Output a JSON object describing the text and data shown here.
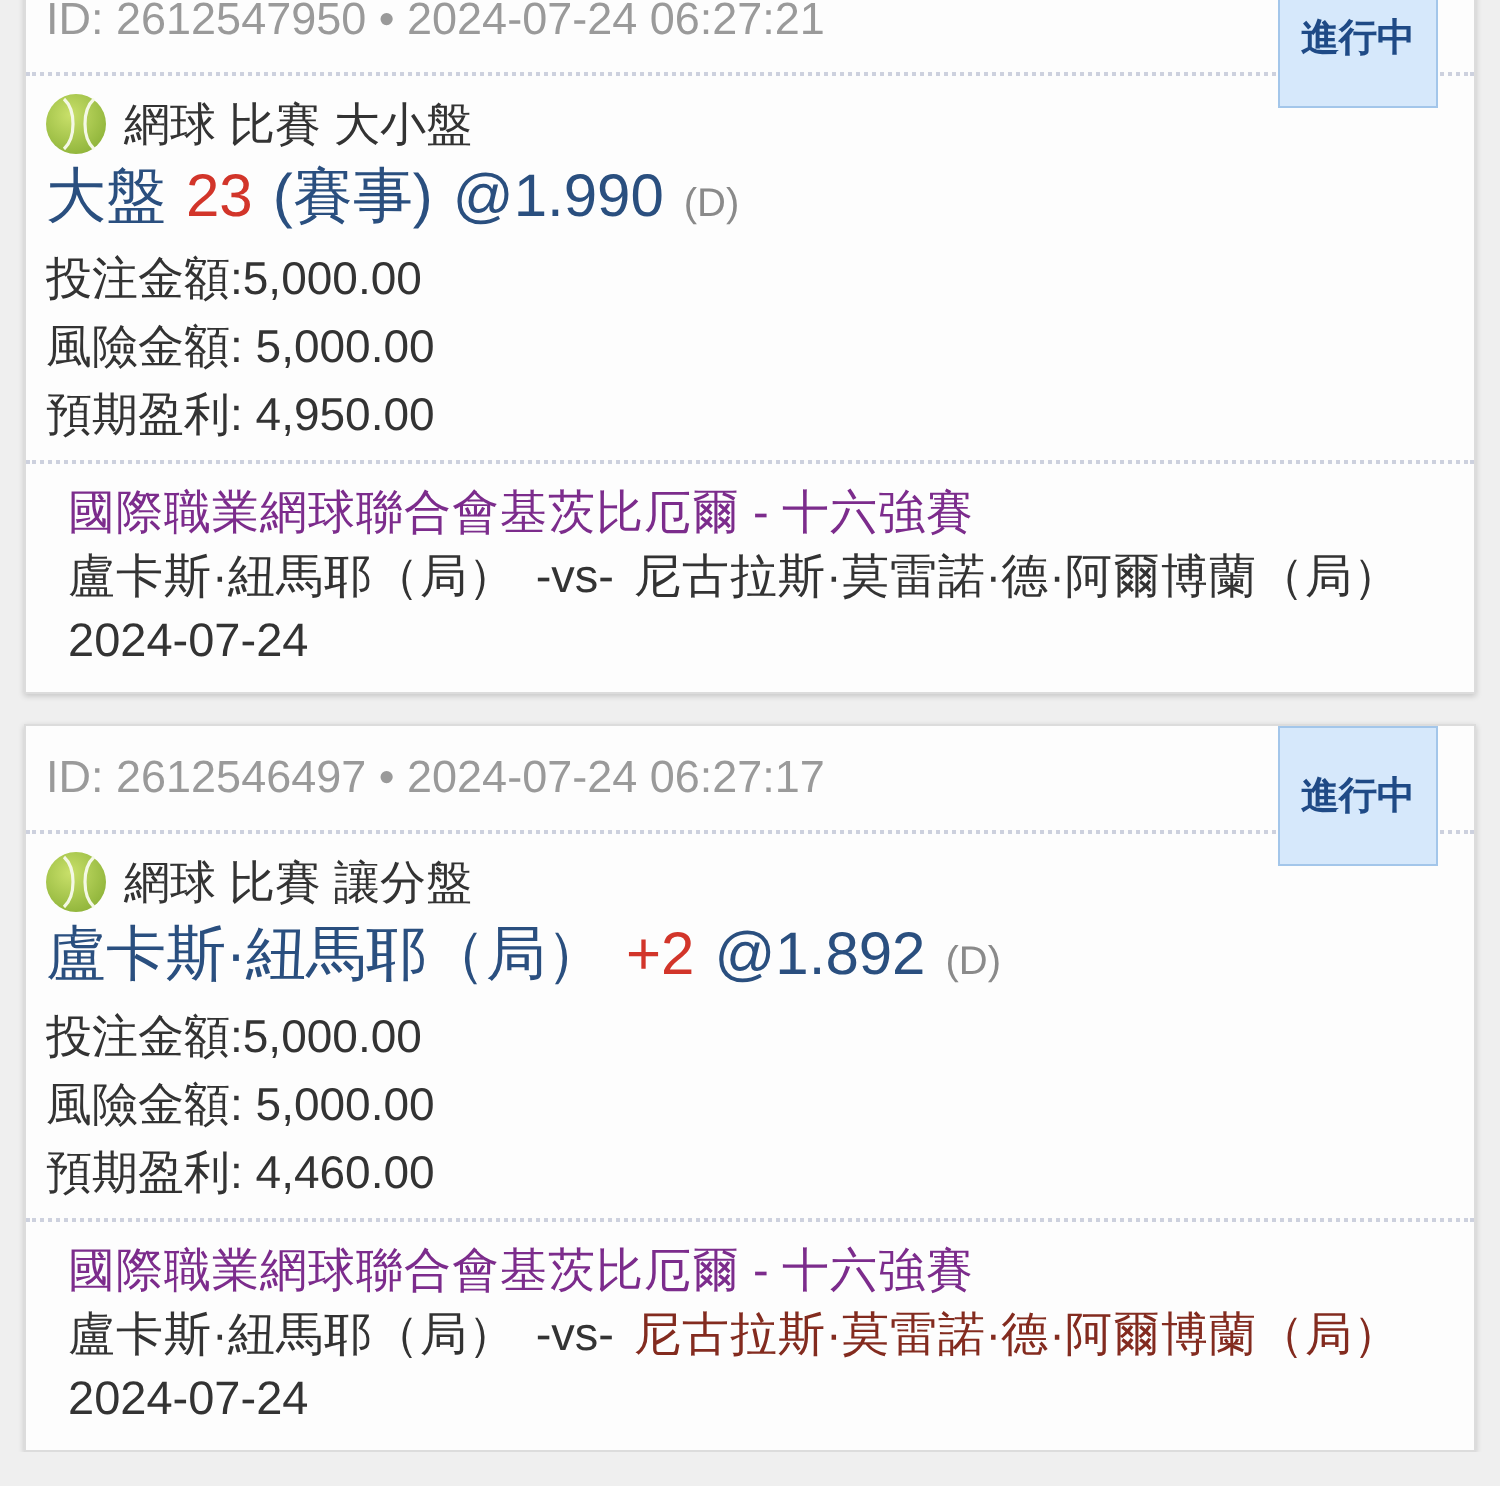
{
  "bets": [
    {
      "header": "ID: 2612547950 • 2024-07-24 06:27:21",
      "status": "進行中",
      "market": "網球 比賽 大小盤",
      "selection": [
        {
          "kind": "pick",
          "text": "大盤"
        },
        {
          "kind": "line",
          "text": "23"
        },
        {
          "kind": "pick",
          "text": "(賽事)"
        },
        {
          "kind": "odds",
          "text": "@1.990"
        },
        {
          "kind": "odds_format",
          "text": "(D)"
        }
      ],
      "details": [
        "投注金額:5,000.00",
        "風險金額: 5,000.00",
        "預期盈利: 4,950.00"
      ],
      "league": "國際職業網球聯合會基茨比厄爾 - 十六強賽",
      "home": {
        "name": "盧卡斯·紐馬耶（局）",
        "highlighted": false
      },
      "versus": "-vs-",
      "away": {
        "name": "尼古拉斯·莫雷諾·德·阿爾博蘭（局）",
        "highlighted": false
      },
      "date": "2024-07-24"
    },
    {
      "header": "ID: 2612546497 • 2024-07-24 06:27:17",
      "status": "進行中",
      "market": "網球 比賽 讓分盤",
      "selection": [
        {
          "kind": "pick",
          "text": "盧卡斯·紐馬耶（局）"
        },
        {
          "kind": "line",
          "text": "+2"
        },
        {
          "kind": "odds",
          "text": "@1.892"
        },
        {
          "kind": "odds_format",
          "text": "(D)"
        }
      ],
      "details": [
        "投注金額:5,000.00",
        "風險金額: 5,000.00",
        "預期盈利: 4,460.00"
      ],
      "league": "國際職業網球聯合會基茨比厄爾 - 十六強賽",
      "home": {
        "name": "盧卡斯·紐馬耶（局）",
        "highlighted": false
      },
      "versus": "-vs-",
      "away": {
        "name": "尼古拉斯·莫雷諾·德·阿爾博蘭（局）",
        "highlighted": true
      },
      "date": "2024-07-24"
    }
  ]
}
